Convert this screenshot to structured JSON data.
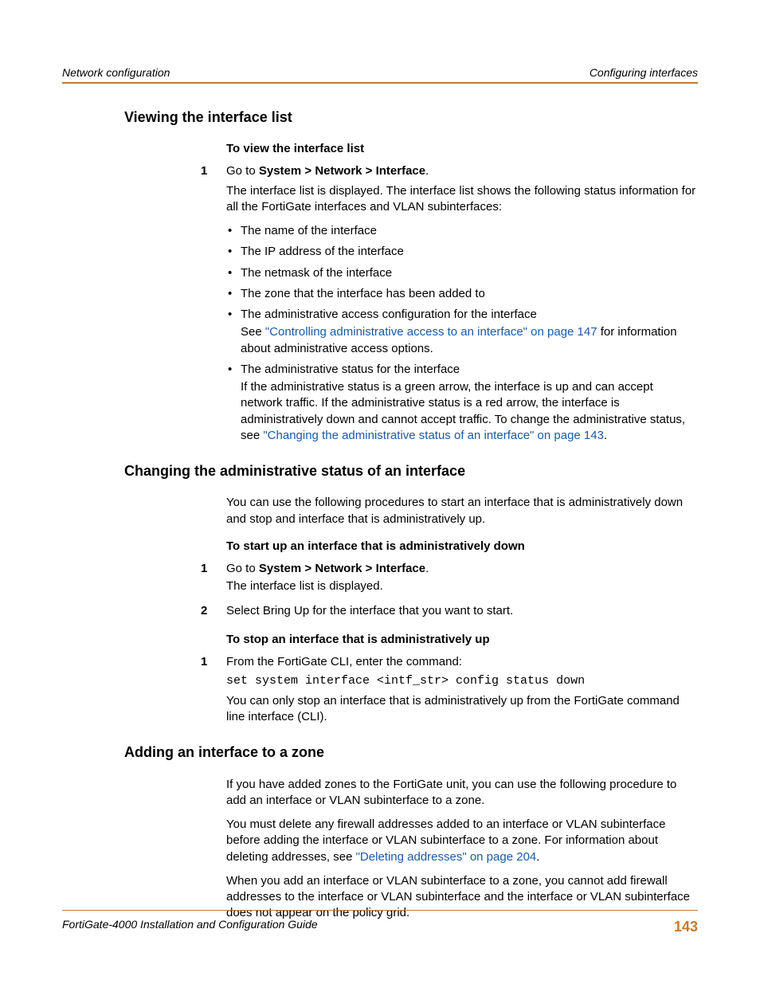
{
  "header": {
    "left": "Network configuration",
    "right": "Configuring interfaces"
  },
  "sections": {
    "s1": {
      "title": "Viewing the interface list",
      "sub1": "To view the interface list",
      "step1_num": "1",
      "step1_a": "Go to ",
      "step1_path": "System > Network > Interface",
      "step1_b": ".",
      "step1_desc": "The interface list is displayed. The interface list shows the following status information for all the FortiGate interfaces and VLAN subinterfaces:",
      "bullets": {
        "b1": "The name of the interface",
        "b2": "The IP address of the interface",
        "b3": "The netmask of the interface",
        "b4": "The zone that the interface has been added to",
        "b5": "The administrative access configuration for the interface",
        "b5_body_a": "See ",
        "b5_link": "\"Controlling administrative access to an interface\" on page 147",
        "b5_body_b": " for information about administrative access options.",
        "b6": "The administrative status for the interface",
        "b6_body_a": "If the administrative status is a green arrow, the interface is up and can accept network traffic. If the administrative status is a red arrow, the interface is administratively down and cannot accept traffic. To change the administrative status, see ",
        "b6_link": "\"Changing the administrative status of an interface\" on page 143",
        "b6_body_b": "."
      }
    },
    "s2": {
      "title": "Changing the administrative status of an interface",
      "intro": "You can use the following procedures to start an interface that is administratively down and stop and interface that is administratively up.",
      "sub1": "To start up an interface that is administratively down",
      "step1_num": "1",
      "step1_a": "Go to ",
      "step1_path": "System > Network > Interface",
      "step1_b": ".",
      "step1_desc": "The interface list is displayed.",
      "step2_num": "2",
      "step2": "Select Bring Up for the interface that you want to start.",
      "sub2": "To stop an interface that is administratively up",
      "step3_num": "1",
      "step3": "From the FortiGate CLI, enter the command:",
      "step3_code": "set system interface <intf_str> config status down",
      "step3_desc": "You can only stop an interface that is administratively up from the FortiGate command line interface (CLI)."
    },
    "s3": {
      "title": "Adding an interface to a zone",
      "p1": "If you have added zones to the FortiGate unit, you can use the following procedure to add an interface or VLAN subinterface to a zone.",
      "p2_a": "You must delete any firewall addresses added to an interface or VLAN subinterface before adding the interface or VLAN subinterface to a zone. For information about deleting addresses, see ",
      "p2_link": "\"Deleting addresses\" on page 204",
      "p2_b": ".",
      "p3": "When you add an interface or VLAN subinterface to a zone, you cannot add firewall addresses to the interface or VLAN subinterface and the interface or VLAN subinterface does not appear on the policy grid."
    }
  },
  "footer": {
    "title": "FortiGate-4000 Installation and Configuration Guide",
    "page": "143"
  }
}
